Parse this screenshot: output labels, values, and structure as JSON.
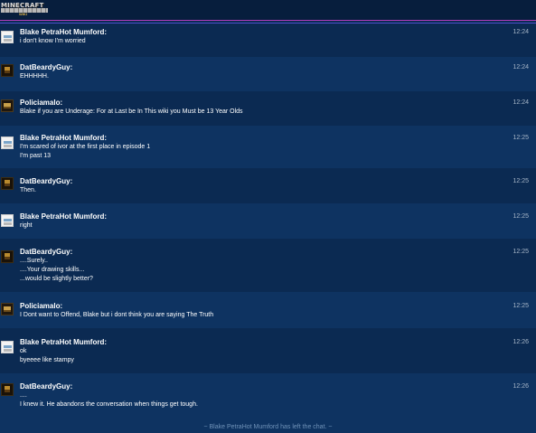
{
  "logo": {
    "top": "MINECRAFT",
    "middle": "STORY MODE",
    "bottom": "WIKI"
  },
  "messages": [
    {
      "user": "Blake PetraHot Mumford:",
      "time": "12:24",
      "avatar": "white-avatar",
      "lines": [
        "i don't know I'm worried"
      ]
    },
    {
      "user": "DatBeardyGuy:",
      "time": "12:24",
      "avatar": "dark-avatar",
      "lines": [
        "EHHHHH."
      ]
    },
    {
      "user": "Policiamalo:",
      "time": "12:24",
      "avatar": "policiamalo-avatar",
      "lines": [
        "Blake if you are Underage: For at Last be In This wiki you Must be 13 Year Olds"
      ]
    },
    {
      "user": "Blake PetraHot Mumford:",
      "time": "12:25",
      "avatar": "white-avatar",
      "lines": [
        "I'm scared of ivor at the first place in episode 1",
        "I'm past 13"
      ]
    },
    {
      "user": "DatBeardyGuy:",
      "time": "12:25",
      "avatar": "dark-avatar",
      "lines": [
        "Then."
      ]
    },
    {
      "user": "Blake PetraHot Mumford:",
      "time": "12:25",
      "avatar": "white-avatar",
      "lines": [
        "right"
      ]
    },
    {
      "user": "DatBeardyGuy:",
      "time": "12:25",
      "avatar": "dark-avatar",
      "lines": [
        "....Surely..",
        "....Your drawing skills...",
        "...would be slightly better?"
      ]
    },
    {
      "user": "Policiamalo:",
      "time": "12:25",
      "avatar": "policiamalo-avatar",
      "lines": [
        "I Dont want to Offend, Blake but i dont think you are saying The Truth"
      ]
    },
    {
      "user": "Blake PetraHot Mumford:",
      "time": "12:26",
      "avatar": "white-avatar",
      "lines": [
        "ok",
        "byeeee like stampy"
      ]
    },
    {
      "user": "DatBeardyGuy:",
      "time": "12:26",
      "avatar": "dark-avatar",
      "lines": [
        "....",
        "I knew it. He abandons the conversation when things get tough."
      ]
    }
  ],
  "status": "~ Blake PetraHot Mumford has left the chat. ~",
  "colors": {
    "background": "#0b2a52",
    "alt_row": "#0e3361",
    "header": "#071e3d",
    "header_accent_1": "#b33cbb",
    "header_accent_2": "#4c4fc9",
    "username": "#ffffff",
    "timestamp": "#a7b6c8",
    "status_text": "#6f92b8"
  }
}
